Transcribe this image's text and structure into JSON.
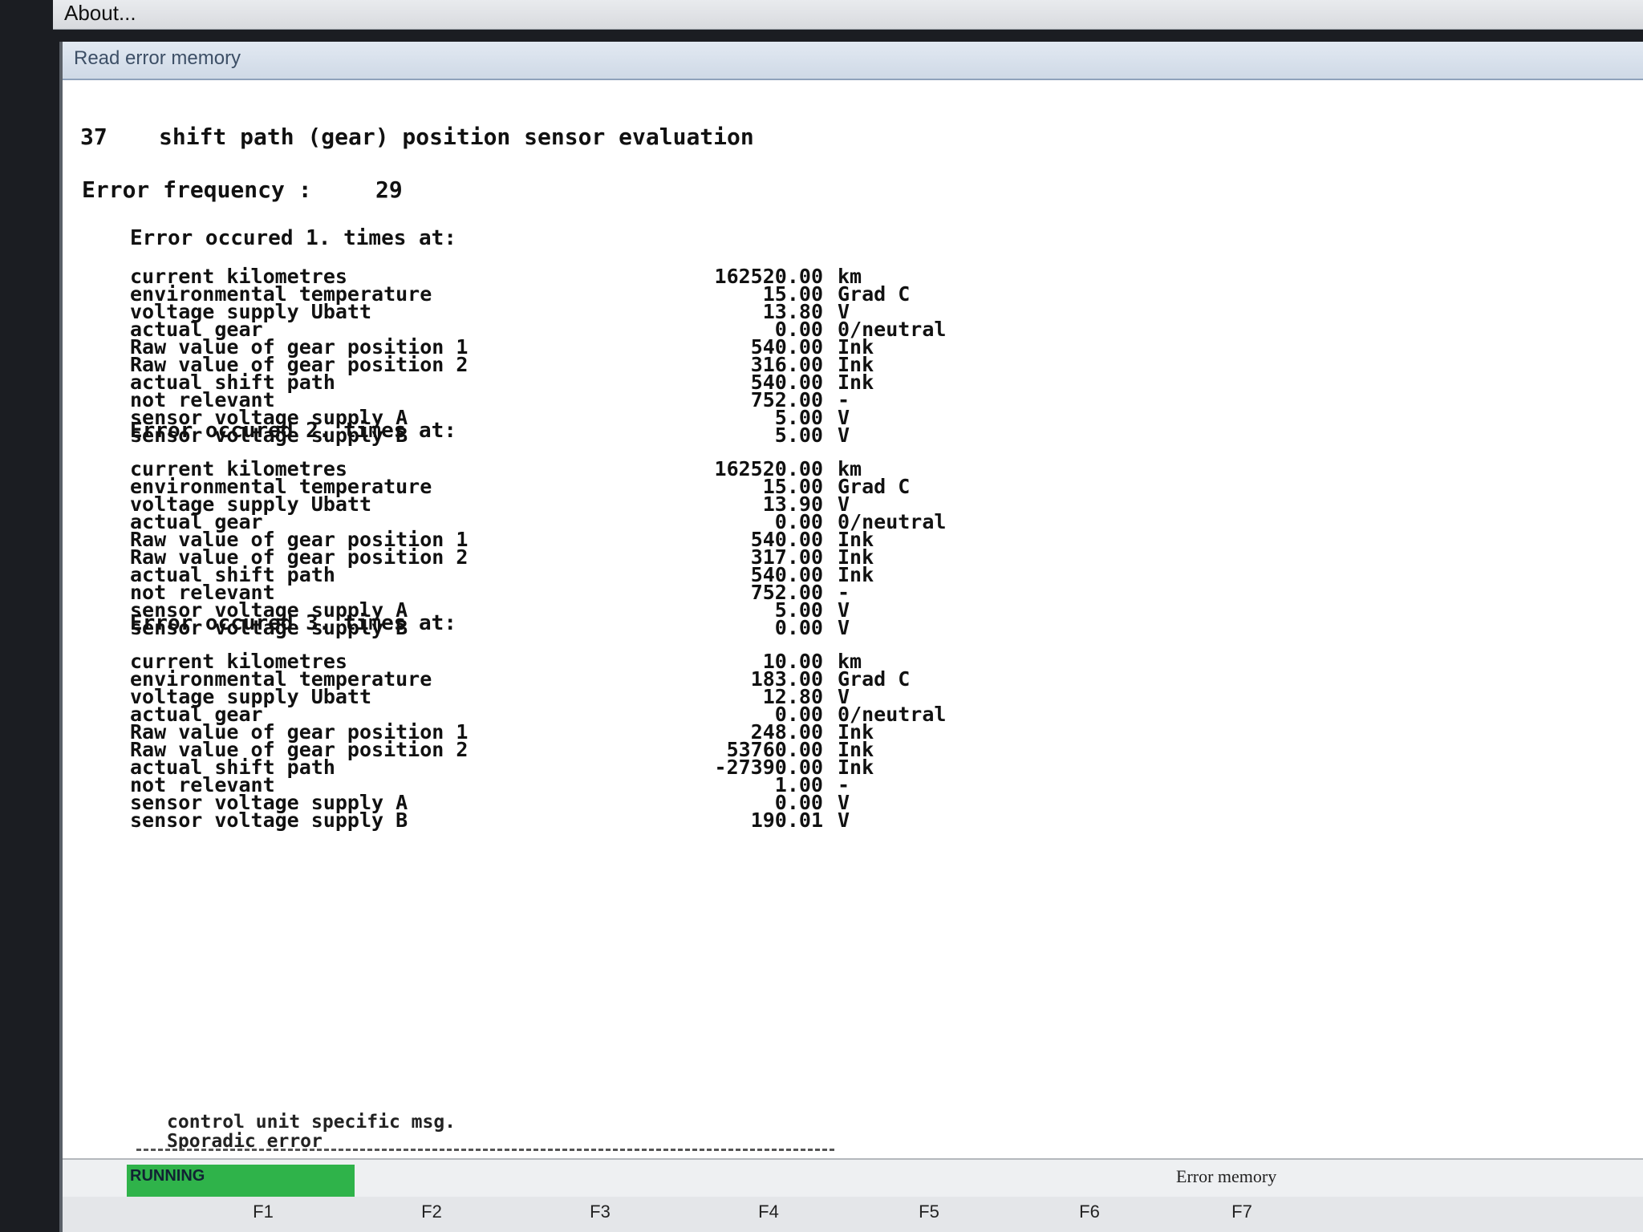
{
  "menu": {
    "about_label": "About..."
  },
  "window": {
    "title": "Read error memory"
  },
  "error": {
    "code": "37",
    "title": "shift path (gear) position sensor evaluation",
    "frequency_label": "Error frequency :",
    "frequency_value": "29"
  },
  "occurrences": [
    {
      "heading": "Error occured 1. times at:",
      "rows": [
        {
          "label": "current kilometres",
          "value": "162520.00",
          "unit": "km"
        },
        {
          "label": "environmental temperature",
          "value": "15.00",
          "unit": "Grad C"
        },
        {
          "label": "voltage supply Ubatt",
          "value": "13.80",
          "unit": "V"
        },
        {
          "label": "actual gear",
          "value": "0.00",
          "unit": "0/neutral"
        },
        {
          "label": "Raw value of gear position 1",
          "value": "540.00",
          "unit": "Ink"
        },
        {
          "label": "Raw value of gear position 2",
          "value": "316.00",
          "unit": "Ink"
        },
        {
          "label": "actual shift path",
          "value": "540.00",
          "unit": "Ink"
        },
        {
          "label": "not relevant",
          "value": "752.00",
          "unit": "-"
        },
        {
          "label": "sensor voltage supply A",
          "value": "5.00",
          "unit": "V"
        },
        {
          "label": "sensor voltage supply B",
          "value": "5.00",
          "unit": "V"
        }
      ]
    },
    {
      "heading": "Error occured 2. times at:",
      "rows": [
        {
          "label": "current kilometres",
          "value": "162520.00",
          "unit": "km"
        },
        {
          "label": "environmental temperature",
          "value": "15.00",
          "unit": "Grad C"
        },
        {
          "label": "voltage supply Ubatt",
          "value": "13.90",
          "unit": "V"
        },
        {
          "label": "actual gear",
          "value": "0.00",
          "unit": "0/neutral"
        },
        {
          "label": "Raw value of gear position 1",
          "value": "540.00",
          "unit": "Ink"
        },
        {
          "label": "Raw value of gear position 2",
          "value": "317.00",
          "unit": "Ink"
        },
        {
          "label": "actual shift path",
          "value": "540.00",
          "unit": "Ink"
        },
        {
          "label": "not relevant",
          "value": "752.00",
          "unit": "-"
        },
        {
          "label": "sensor voltage supply A",
          "value": "5.00",
          "unit": "V"
        },
        {
          "label": "sensor voltage supply B",
          "value": "0.00",
          "unit": "V"
        }
      ]
    },
    {
      "heading": "Error occured 3. times at:",
      "rows": [
        {
          "label": "current kilometres",
          "value": "10.00",
          "unit": "km"
        },
        {
          "label": "environmental temperature",
          "value": "183.00",
          "unit": "Grad C"
        },
        {
          "label": "voltage supply Ubatt",
          "value": "12.80",
          "unit": "V"
        },
        {
          "label": "actual gear",
          "value": "0.00",
          "unit": "0/neutral"
        },
        {
          "label": "Raw value of gear position 1",
          "value": "248.00",
          "unit": "Ink"
        },
        {
          "label": "Raw value of gear position 2",
          "value": "53760.00",
          "unit": "Ink"
        },
        {
          "label": "actual shift path",
          "value": "-27390.00",
          "unit": "Ink"
        },
        {
          "label": "not relevant",
          "value": "1.00",
          "unit": "-"
        },
        {
          "label": "sensor voltage supply A",
          "value": "0.00",
          "unit": "V"
        },
        {
          "label": "sensor voltage supply B",
          "value": "190.01",
          "unit": "V"
        }
      ]
    }
  ],
  "footer": {
    "msg1": "control unit specific msg.",
    "msg2": "Sporadic error",
    "scroll_hint": "<"
  },
  "status": {
    "state": "RUNNING",
    "screen_title": "Error memory",
    "state_color": "#2fb34a"
  },
  "function_keys": [
    "F1",
    "F2",
    "F3",
    "F4",
    "F5",
    "F6",
    "F7"
  ]
}
